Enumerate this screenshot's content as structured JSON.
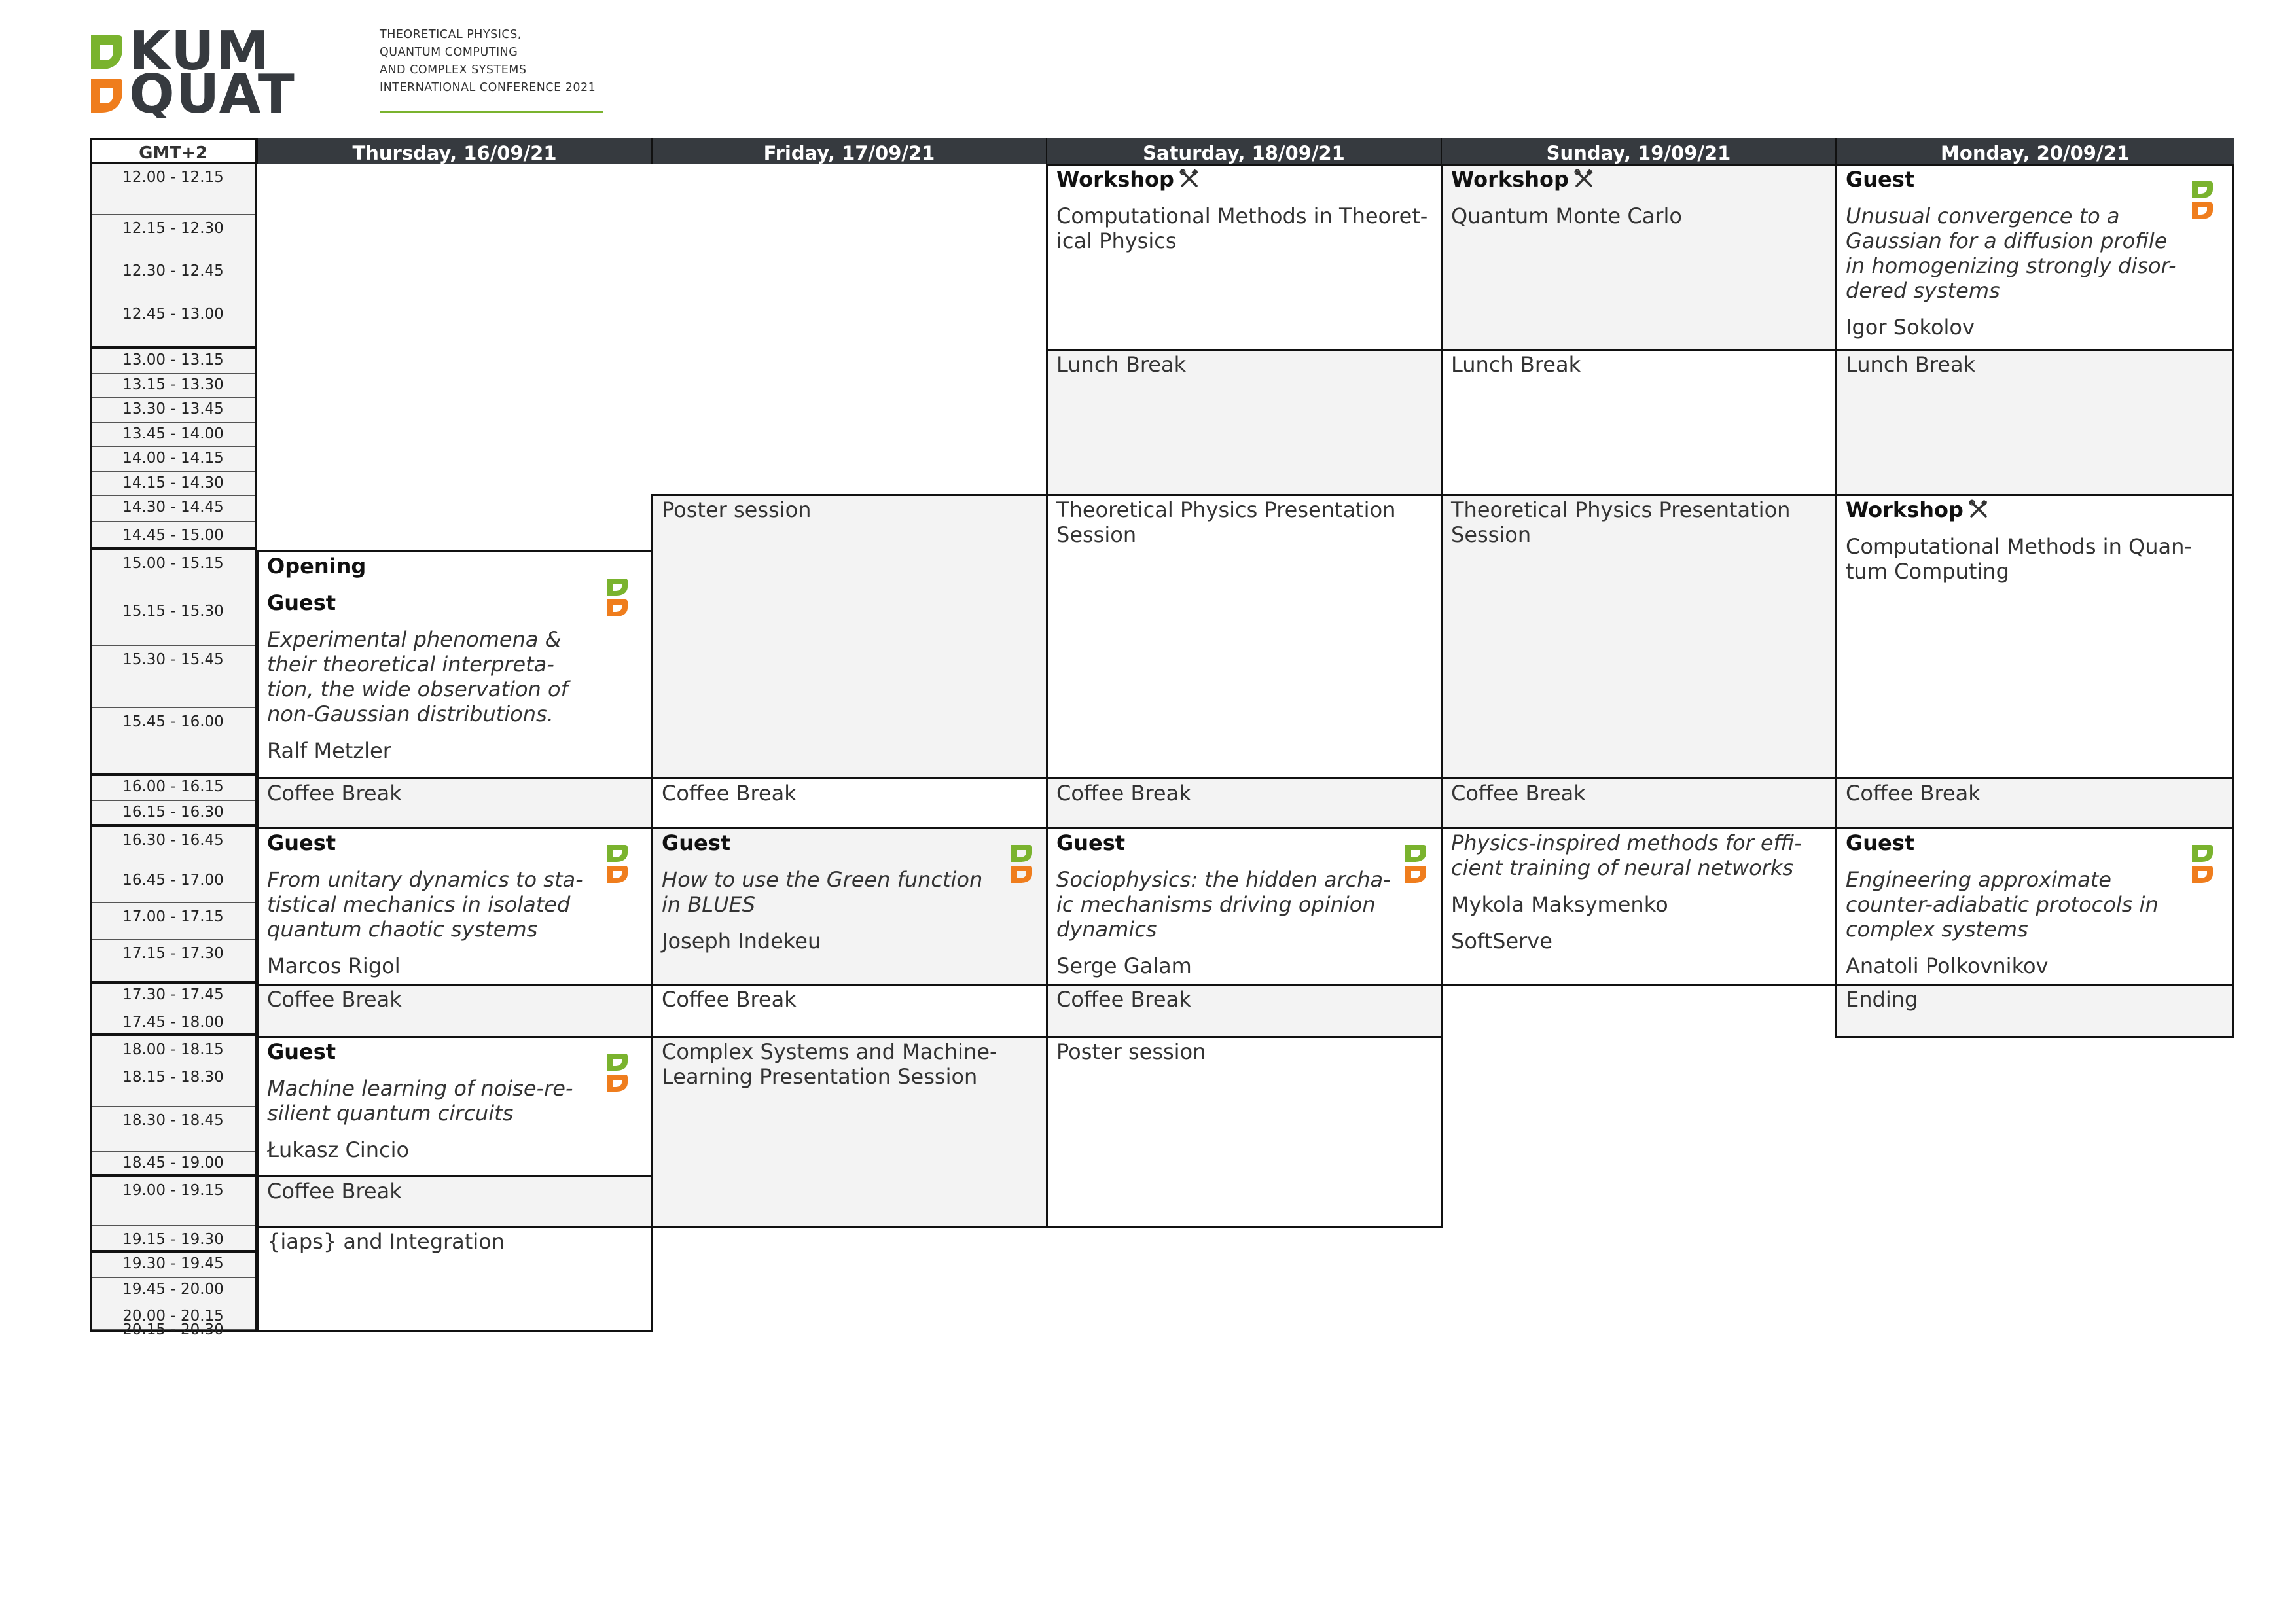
{
  "conference": {
    "logo_line1": "KUM",
    "logo_line2": "QUAT",
    "tagline": [
      "THEORETICAL PHYSICS,",
      "QUANTUM COMPUTING",
      "AND COMPLEX SYSTEMS",
      "INTERNATIONAL CONFERENCE 2021"
    ]
  },
  "colors": {
    "green": "#7ab32e",
    "orange": "#ef7d1d",
    "dark": "#363a3f",
    "grey_cell": "#f3f3f3"
  },
  "timezone": "GMT+2",
  "days": [
    "Thursday, 16/09/21",
    "Friday, 17/09/21",
    "Saturday, 18/09/21",
    "Sunday, 19/09/21",
    "Monday, 20/09/21"
  ],
  "time_slots": [
    "12.00 - 12.15",
    "12.15 - 12.30",
    "12.30 - 12.45",
    "12.45 - 13.00",
    "13.00 - 13.15",
    "13.15 - 13.30",
    "13.30 - 13.45",
    "13.45 - 14.00",
    "14.00 - 14.15",
    "14.15 - 14.30",
    "14.30 - 14.45",
    "14.45 - 15.00",
    "15.00 - 15.15",
    "15.15 - 15.30",
    "15.30 - 15.45",
    "15.45 - 16.00",
    "16.00 - 16.15",
    "16.15 - 16.30",
    "16.30 - 16.45",
    "16.45 - 17.00",
    "17.00 - 17.15",
    "17.15 - 17.30",
    "17.30 - 17.45",
    "17.45 - 18.00",
    "18.00 - 18.15",
    "18.15 - 18.30",
    "18.30 - 18.45",
    "18.45 - 19.00",
    "19.00 - 19.15",
    "19.15 - 19.30",
    "19.30 - 19.45",
    "19.45 - 20.00",
    "20.00 - 20.15",
    "20.15 - 20.30"
  ],
  "labels": {
    "opening": "Opening",
    "guest": "Guest",
    "workshop": "Workshop"
  },
  "events": {
    "thu_opening": {
      "speaker": "Ralf Metzler",
      "title": [
        "Experimental phenomena &",
        "their theoretical interpreta-",
        "tion, the wide observation of",
        "non-Gaussian distributions."
      ]
    },
    "thu_coffee1": "Coffee Break",
    "thu_guest2": {
      "speaker": "Marcos Rigol",
      "title": [
        "From unitary dynamics to sta-",
        "tistical mechanics in isolated",
        "quantum chaotic systems"
      ]
    },
    "thu_coffee2": "Coffee Break",
    "thu_guest3": {
      "speaker": "Łukasz Cincio",
      "title": [
        "Machine learning of noise-re-",
        "silient quantum circuits"
      ]
    },
    "thu_coffee3": "Coffee Break",
    "thu_iaps": "{iaps} and Integration",
    "fri_poster": "Poster session",
    "fri_coffee1": "Coffee Break",
    "fri_guest": {
      "speaker": "Joseph Indekeu",
      "title": [
        "How to use the Green function",
        "in BLUES"
      ]
    },
    "fri_coffee2": "Coffee Break",
    "fri_session": [
      "Complex Systems and Machine-",
      "Learning Presentation Session"
    ],
    "sat_workshop": [
      "Computational Methods in Theoret-",
      "ical Physics"
    ],
    "sat_lunch": "Lunch Break",
    "sat_session": [
      "Theoretical Physics Presentation",
      "Session"
    ],
    "sat_coffee1": "Coffee Break",
    "sat_guest": {
      "speaker": "Serge Galam",
      "title": [
        "Sociophysics: the hidden archa-",
        "ic mechanisms driving opinion",
        "dynamics"
      ]
    },
    "sat_coffee2": "Coffee Break",
    "sat_poster": "Poster session",
    "sun_workshop": "Quantum Monte Carlo",
    "sun_lunch": "Lunch Break",
    "sun_session": [
      "Theoretical Physics Presentation",
      "Session"
    ],
    "sun_coffee": "Coffee Break",
    "sun_talk": {
      "title": [
        "Physics-inspired methods for effi-",
        "cient training of neural networks"
      ],
      "speaker": "Mykola Maksymenko",
      "org": "SoftServe"
    },
    "mon_guest1": {
      "speaker": "Igor Sokolov",
      "title": [
        "Unusual convergence to a",
        "Gaussian for a diffusion profile",
        "in homogenizing strongly disor-",
        "dered systems"
      ]
    },
    "mon_lunch": "Lunch Break",
    "mon_workshop": [
      "Computational Methods in Quan-",
      "tum Computing"
    ],
    "mon_coffee": "Coffee Break",
    "mon_guest2": {
      "speaker": "Anatoli Polkovnikov",
      "title": [
        "Engineering approximate",
        "counter-adiabatic protocols in",
        "complex systems"
      ]
    },
    "mon_ending": "Ending"
  }
}
